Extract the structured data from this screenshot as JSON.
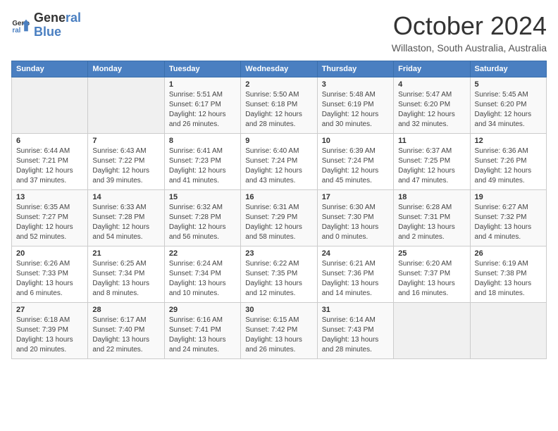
{
  "header": {
    "logo_line1": "General",
    "logo_line2": "Blue",
    "month": "October 2024",
    "location": "Willaston, South Australia, Australia"
  },
  "days_of_week": [
    "Sunday",
    "Monday",
    "Tuesday",
    "Wednesday",
    "Thursday",
    "Friday",
    "Saturday"
  ],
  "weeks": [
    [
      {
        "num": "",
        "info": ""
      },
      {
        "num": "",
        "info": ""
      },
      {
        "num": "1",
        "info": "Sunrise: 5:51 AM\nSunset: 6:17 PM\nDaylight: 12 hours\nand 26 minutes."
      },
      {
        "num": "2",
        "info": "Sunrise: 5:50 AM\nSunset: 6:18 PM\nDaylight: 12 hours\nand 28 minutes."
      },
      {
        "num": "3",
        "info": "Sunrise: 5:48 AM\nSunset: 6:19 PM\nDaylight: 12 hours\nand 30 minutes."
      },
      {
        "num": "4",
        "info": "Sunrise: 5:47 AM\nSunset: 6:20 PM\nDaylight: 12 hours\nand 32 minutes."
      },
      {
        "num": "5",
        "info": "Sunrise: 5:45 AM\nSunset: 6:20 PM\nDaylight: 12 hours\nand 34 minutes."
      }
    ],
    [
      {
        "num": "6",
        "info": "Sunrise: 6:44 AM\nSunset: 7:21 PM\nDaylight: 12 hours\nand 37 minutes."
      },
      {
        "num": "7",
        "info": "Sunrise: 6:43 AM\nSunset: 7:22 PM\nDaylight: 12 hours\nand 39 minutes."
      },
      {
        "num": "8",
        "info": "Sunrise: 6:41 AM\nSunset: 7:23 PM\nDaylight: 12 hours\nand 41 minutes."
      },
      {
        "num": "9",
        "info": "Sunrise: 6:40 AM\nSunset: 7:24 PM\nDaylight: 12 hours\nand 43 minutes."
      },
      {
        "num": "10",
        "info": "Sunrise: 6:39 AM\nSunset: 7:24 PM\nDaylight: 12 hours\nand 45 minutes."
      },
      {
        "num": "11",
        "info": "Sunrise: 6:37 AM\nSunset: 7:25 PM\nDaylight: 12 hours\nand 47 minutes."
      },
      {
        "num": "12",
        "info": "Sunrise: 6:36 AM\nSunset: 7:26 PM\nDaylight: 12 hours\nand 49 minutes."
      }
    ],
    [
      {
        "num": "13",
        "info": "Sunrise: 6:35 AM\nSunset: 7:27 PM\nDaylight: 12 hours\nand 52 minutes."
      },
      {
        "num": "14",
        "info": "Sunrise: 6:33 AM\nSunset: 7:28 PM\nDaylight: 12 hours\nand 54 minutes."
      },
      {
        "num": "15",
        "info": "Sunrise: 6:32 AM\nSunset: 7:28 PM\nDaylight: 12 hours\nand 56 minutes."
      },
      {
        "num": "16",
        "info": "Sunrise: 6:31 AM\nSunset: 7:29 PM\nDaylight: 12 hours\nand 58 minutes."
      },
      {
        "num": "17",
        "info": "Sunrise: 6:30 AM\nSunset: 7:30 PM\nDaylight: 13 hours\nand 0 minutes."
      },
      {
        "num": "18",
        "info": "Sunrise: 6:28 AM\nSunset: 7:31 PM\nDaylight: 13 hours\nand 2 minutes."
      },
      {
        "num": "19",
        "info": "Sunrise: 6:27 AM\nSunset: 7:32 PM\nDaylight: 13 hours\nand 4 minutes."
      }
    ],
    [
      {
        "num": "20",
        "info": "Sunrise: 6:26 AM\nSunset: 7:33 PM\nDaylight: 13 hours\nand 6 minutes."
      },
      {
        "num": "21",
        "info": "Sunrise: 6:25 AM\nSunset: 7:34 PM\nDaylight: 13 hours\nand 8 minutes."
      },
      {
        "num": "22",
        "info": "Sunrise: 6:24 AM\nSunset: 7:34 PM\nDaylight: 13 hours\nand 10 minutes."
      },
      {
        "num": "23",
        "info": "Sunrise: 6:22 AM\nSunset: 7:35 PM\nDaylight: 13 hours\nand 12 minutes."
      },
      {
        "num": "24",
        "info": "Sunrise: 6:21 AM\nSunset: 7:36 PM\nDaylight: 13 hours\nand 14 minutes."
      },
      {
        "num": "25",
        "info": "Sunrise: 6:20 AM\nSunset: 7:37 PM\nDaylight: 13 hours\nand 16 minutes."
      },
      {
        "num": "26",
        "info": "Sunrise: 6:19 AM\nSunset: 7:38 PM\nDaylight: 13 hours\nand 18 minutes."
      }
    ],
    [
      {
        "num": "27",
        "info": "Sunrise: 6:18 AM\nSunset: 7:39 PM\nDaylight: 13 hours\nand 20 minutes."
      },
      {
        "num": "28",
        "info": "Sunrise: 6:17 AM\nSunset: 7:40 PM\nDaylight: 13 hours\nand 22 minutes."
      },
      {
        "num": "29",
        "info": "Sunrise: 6:16 AM\nSunset: 7:41 PM\nDaylight: 13 hours\nand 24 minutes."
      },
      {
        "num": "30",
        "info": "Sunrise: 6:15 AM\nSunset: 7:42 PM\nDaylight: 13 hours\nand 26 minutes."
      },
      {
        "num": "31",
        "info": "Sunrise: 6:14 AM\nSunset: 7:43 PM\nDaylight: 13 hours\nand 28 minutes."
      },
      {
        "num": "",
        "info": ""
      },
      {
        "num": "",
        "info": ""
      }
    ]
  ]
}
